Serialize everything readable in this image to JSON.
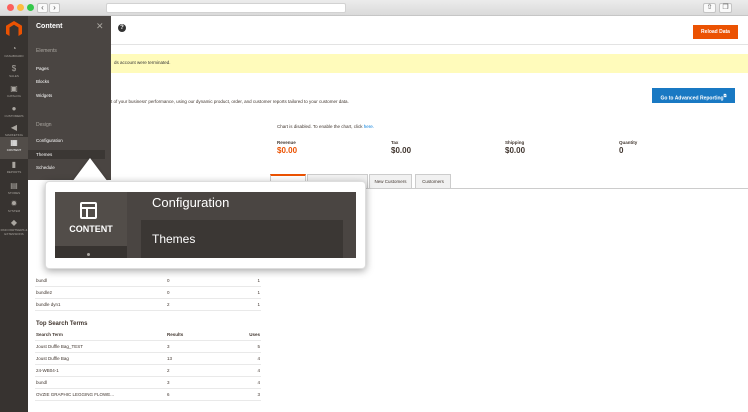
{
  "browser": {
    "back_icon": "chevron-left-icon",
    "forward_icon": "chevron-right-icon",
    "back_glyph": "‹",
    "forward_glyph": "›",
    "share_glyph": "⇧",
    "tabs_glyph": "❐"
  },
  "sidebar": {
    "items": [
      {
        "label": "Dashboard",
        "icon": "speedometer-icon",
        "glyph": "◔"
      },
      {
        "label": "Sales",
        "icon": "dollar-icon",
        "glyph": "$"
      },
      {
        "label": "Catalog",
        "icon": "box-icon",
        "glyph": "▣"
      },
      {
        "label": "Customers",
        "icon": "person-icon",
        "glyph": "●"
      },
      {
        "label": "Marketing",
        "icon": "megaphone-icon",
        "glyph": "◀"
      },
      {
        "label": "Content",
        "icon": "layout-icon",
        "glyph": "▦"
      },
      {
        "label": "Reports",
        "icon": "bar-chart-icon",
        "glyph": "▮"
      },
      {
        "label": "Stores",
        "icon": "store-icon",
        "glyph": "▤"
      },
      {
        "label": "System",
        "icon": "gear-icon",
        "glyph": "✹"
      },
      {
        "label": "Find Partners & Extensions",
        "icon": "cubes-icon",
        "glyph": "◆"
      }
    ]
  },
  "flyout": {
    "title": "Content",
    "close_glyph": "✕",
    "sections": [
      {
        "title": "Elements",
        "links": [
          "Pages",
          "Blocks",
          "Widgets"
        ]
      },
      {
        "title": "Design",
        "links": [
          "Configuration",
          "Themes",
          "Schedule"
        ]
      }
    ]
  },
  "header": {
    "help_glyph": "?",
    "reload_label": "Reload Data"
  },
  "notice": {
    "text": "ds account were terminated."
  },
  "intro": {
    "text": "t of your business' performance, using our dynamic product, order, and customer reports tailored to your customer data.",
    "advanced_label": "Go to Advanced Reporting",
    "advanced_icon_glyph": "⧉"
  },
  "chart": {
    "disabled_text": "Chart is disabled. To enable the chart, click",
    "link_text": "here."
  },
  "metrics": [
    {
      "label": "Revenue",
      "value": "$0.00"
    },
    {
      "label": "Tax",
      "value": "$0.00"
    },
    {
      "label": "Shipping",
      "value": "$0.00"
    },
    {
      "label": "Quantity",
      "value": "0"
    }
  ],
  "tabs": [
    "",
    "",
    "New Customers",
    "Customers"
  ],
  "last_search_rows": [
    {
      "term": "bundl",
      "results": "0",
      "uses": "1"
    },
    {
      "term": "bundle2",
      "results": "0",
      "uses": "1"
    },
    {
      "term": "bundle dyn1",
      "results": "2",
      "uses": "1"
    }
  ],
  "top_search": {
    "title": "Top Search Terms",
    "columns": [
      "Search Term",
      "Results",
      "Uses"
    ],
    "rows": [
      {
        "term": "Joust Duffle Bag_TEST",
        "results": "3",
        "uses": "5"
      },
      {
        "term": "Joust Duffle Bag",
        "results": "13",
        "uses": "4"
      },
      {
        "term": "24-WB04-1",
        "results": "2",
        "uses": "4"
      },
      {
        "term": "bundl",
        "results": "3",
        "uses": "4"
      },
      {
        "term": "OVZIE GRAPHIC LEGGING FLOWE...",
        "results": "6",
        "uses": "3"
      }
    ]
  },
  "zoom": {
    "nav_label": "CONTENT",
    "link1": "Configuration",
    "link2": "Themes"
  }
}
